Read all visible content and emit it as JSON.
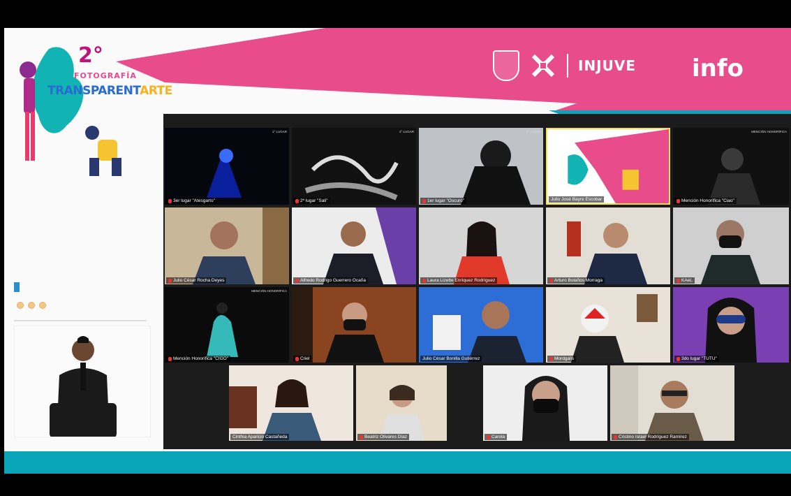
{
  "event": {
    "logo_number": "2°",
    "logo_subtitle": "FOTOGRAFÍA",
    "logo_trans": "TRANSPARENT",
    "logo_arte": "ARTE",
    "partner_name": "INJUVE",
    "info_logo": "info"
  },
  "participants": [
    {
      "id": "t1",
      "name": "3er lugar \"Atesgarto\"",
      "corner": "1° LUGAR"
    },
    {
      "id": "t2",
      "name": "2º lugar \"Sali\"",
      "corner": "2° LUGAR"
    },
    {
      "id": "t3",
      "name": "1er lugar \"Oscuro\"",
      "corner": "3° LUGAR"
    },
    {
      "id": "t4",
      "name": "Julio José Bayre Escobar",
      "corner": ""
    },
    {
      "id": "t5",
      "name": "Mención Honorífica \"Ciao\"",
      "corner": "MENCIÓN HONORÍFICA"
    },
    {
      "id": "t6",
      "name": "Julio César Rocha Deyes",
      "corner": ""
    },
    {
      "id": "t7",
      "name": "Alfredo Rodrigo Guerrero Ocaña",
      "corner": ""
    },
    {
      "id": "t8",
      "name": "Laura Lizette Enríquez Rodríguez",
      "corner": ""
    },
    {
      "id": "t9",
      "name": "Arturo Bolaños Morraga",
      "corner": ""
    },
    {
      "id": "t10",
      "name": "KAeL",
      "corner": ""
    },
    {
      "id": "t11",
      "name": "Mención Honorífica \"CIGO\"",
      "corner": "MENCIÓN HONORÍFICA"
    },
    {
      "id": "t12",
      "name": "Criel",
      "corner": ""
    },
    {
      "id": "t13",
      "name": "Julio César Bonilla Gutiérrez",
      "corner": ""
    },
    {
      "id": "t14",
      "name": "Mordgalis",
      "corner": ""
    },
    {
      "id": "t15",
      "name": "3do lugar \"TUTU\"",
      "corner": ""
    },
    {
      "id": "t16",
      "name": "Cinthia Aparicio Castañeda",
      "corner": ""
    },
    {
      "id": "t17",
      "name": "Beatriz Olivares Díaz",
      "corner": ""
    },
    {
      "id": "t18",
      "name": "Carola",
      "corner": ""
    },
    {
      "id": "t19",
      "name": "Cristino Israel Rodríguez Ramírez",
      "corner": ""
    }
  ],
  "colors": {
    "brand_pink": "#e84c8b",
    "brand_teal": "#0aa5b8",
    "gallery_bg": "#1b1b1b"
  }
}
